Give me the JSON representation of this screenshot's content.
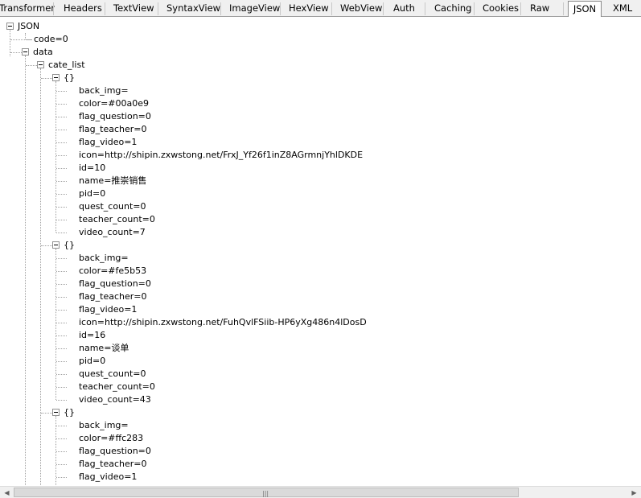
{
  "tabs": [
    {
      "label": "Transformer"
    },
    {
      "label": "Headers"
    },
    {
      "label": "TextView"
    },
    {
      "label": "SyntaxView"
    },
    {
      "label": "ImageView"
    },
    {
      "label": "HexView"
    },
    {
      "label": "WebView"
    },
    {
      "label": "Auth"
    },
    {
      "label": "Caching"
    },
    {
      "label": "Cookies"
    },
    {
      "label": "Raw"
    },
    {
      "label": "JSON"
    },
    {
      "label": "XML"
    }
  ],
  "active_tab": "JSON",
  "tree": {
    "root": "JSON",
    "code": "code=0",
    "data": "data",
    "cate_list": "cate_list",
    "items": [
      {
        "label": "{}",
        "fields": [
          "back_img=",
          "color=#00a0e9",
          "flag_question=0",
          "flag_teacher=0",
          "flag_video=1",
          "icon=http://shipin.zxwstong.net/FrxJ_Yf26f1inZ8AGrmnjYhlDKDE",
          "id=10",
          "name=推崇销售",
          "pid=0",
          "quest_count=0",
          "teacher_count=0",
          "video_count=7"
        ]
      },
      {
        "label": "{}",
        "fields": [
          "back_img=",
          "color=#fe5b53",
          "flag_question=0",
          "flag_teacher=0",
          "flag_video=1",
          "icon=http://shipin.zxwstong.net/FuhQvlFSiib-HP6yXg486n4lDosD",
          "id=16",
          "name=谈单",
          "pid=0",
          "quest_count=0",
          "teacher_count=0",
          "video_count=43"
        ]
      },
      {
        "label": "{}",
        "fields": [
          "back_img=",
          "color=#ffc283",
          "flag_question=0",
          "flag_teacher=0",
          "flag_video=1"
        ]
      }
    ]
  },
  "scrollbar": {
    "left_arrow": "◀",
    "right_arrow": "▶",
    "grip": "|||"
  }
}
